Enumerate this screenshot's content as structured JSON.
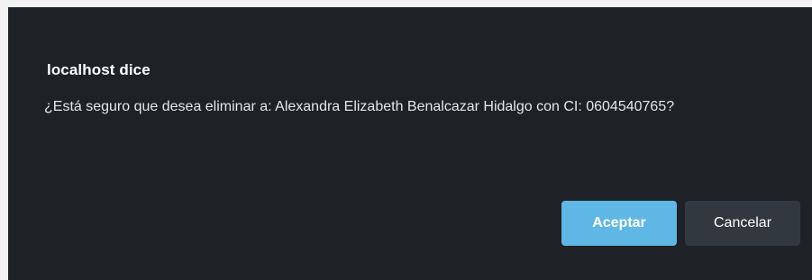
{
  "dialog": {
    "title": "localhost dice",
    "message": "¿Está seguro que desea eliminar a: Alexandra Elizabeth Benalcazar Hidalgo con CI: 0604540765?",
    "accept_label": "Aceptar",
    "cancel_label": "Cancelar"
  },
  "colors": {
    "dialog_background": "#1e2227",
    "accept_button": "#5fb7e6",
    "cancel_button": "#313840",
    "text": "#ffffff"
  }
}
